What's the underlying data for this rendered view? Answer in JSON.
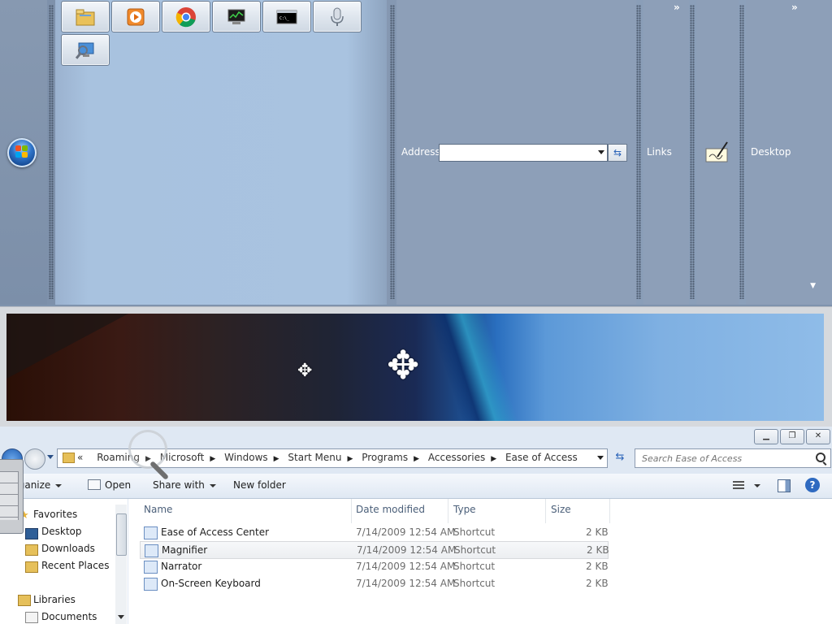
{
  "taskbar": {
    "quick_launch": [
      "file-explorer-icon",
      "media-player-icon",
      "chrome-icon",
      "task-manager-icon",
      "command-prompt-icon",
      "microphone-icon",
      "remote-desktop-icon"
    ],
    "address_label": "Address",
    "address_value": "",
    "links_label": "Links",
    "links_chevron": "»",
    "desktop_label": "Desktop",
    "desktop_chevron": "»"
  },
  "explorer": {
    "breadcrumb": [
      "«",
      "Roaming",
      "Microsoft",
      "Windows",
      "Start Menu",
      "Programs",
      "Accessories",
      "Ease of Access"
    ],
    "search_placeholder": "Search Ease of Access",
    "toolbar": {
      "organize": "rganize",
      "open": "Open",
      "share_with": "Share with",
      "new_folder": "New folder"
    },
    "nav": {
      "favorites": "Favorites",
      "desktop": "Desktop",
      "downloads": "Downloads",
      "recent_places": "Recent Places",
      "libraries": "Libraries",
      "documents": "Documents"
    },
    "columns": [
      "Name",
      "Date modified",
      "Type",
      "Size"
    ],
    "files": [
      {
        "name": "Ease of Access Center",
        "date": "7/14/2009 12:54 AM",
        "type": "Shortcut",
        "size": "2 KB"
      },
      {
        "name": "Magnifier",
        "date": "7/14/2009 12:54 AM",
        "type": "Shortcut",
        "size": "2 KB"
      },
      {
        "name": "Narrator",
        "date": "7/14/2009 12:54 AM",
        "type": "Shortcut",
        "size": "2 KB"
      },
      {
        "name": "On-Screen Keyboard",
        "date": "7/14/2009 12:54 AM",
        "type": "Shortcut",
        "size": "2 KB"
      }
    ],
    "selected_index": 1
  }
}
